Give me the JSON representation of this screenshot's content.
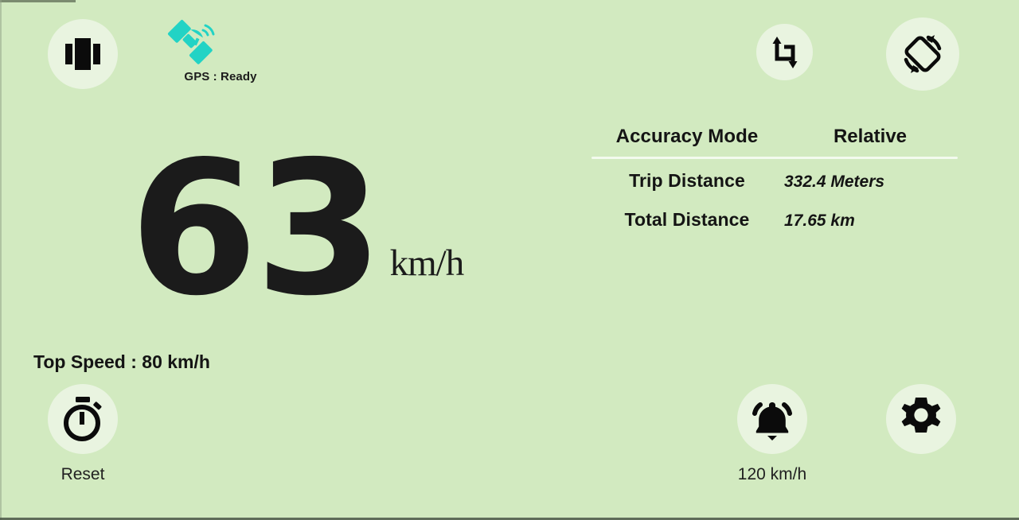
{
  "theme": {
    "background": "#d2eac0",
    "circle_button_fill": "#e9f4e0",
    "icon_color": "#111111",
    "gps_icon_color": "#22d3c5",
    "divider_color": "#f3faee",
    "text_color": "#141414"
  },
  "topbar": {
    "view_mode_icon": "view-carousel-icon",
    "screenshot_icon": "crop-screenshot-icon",
    "rotate_icon": "screen-rotation-icon",
    "gps": {
      "icon": "satellite-icon",
      "label": "GPS : Ready"
    }
  },
  "speed": {
    "value": "63",
    "unit": "km/h"
  },
  "info_panel": {
    "accuracy_mode": {
      "label": "Accuracy Mode",
      "value": "Relative"
    },
    "metrics": [
      {
        "label": "Trip Distance",
        "value": "332.4 Meters"
      },
      {
        "label": "Total Distance",
        "value": "17.65 km"
      }
    ]
  },
  "bottom": {
    "top_speed_label": "Top Speed : 80 km/h",
    "reset": {
      "icon": "stopwatch-icon",
      "label": "Reset"
    },
    "alarm": {
      "icon": "alarm-bell-icon",
      "label": "120 km/h"
    },
    "settings": {
      "icon": "gear-icon"
    }
  }
}
